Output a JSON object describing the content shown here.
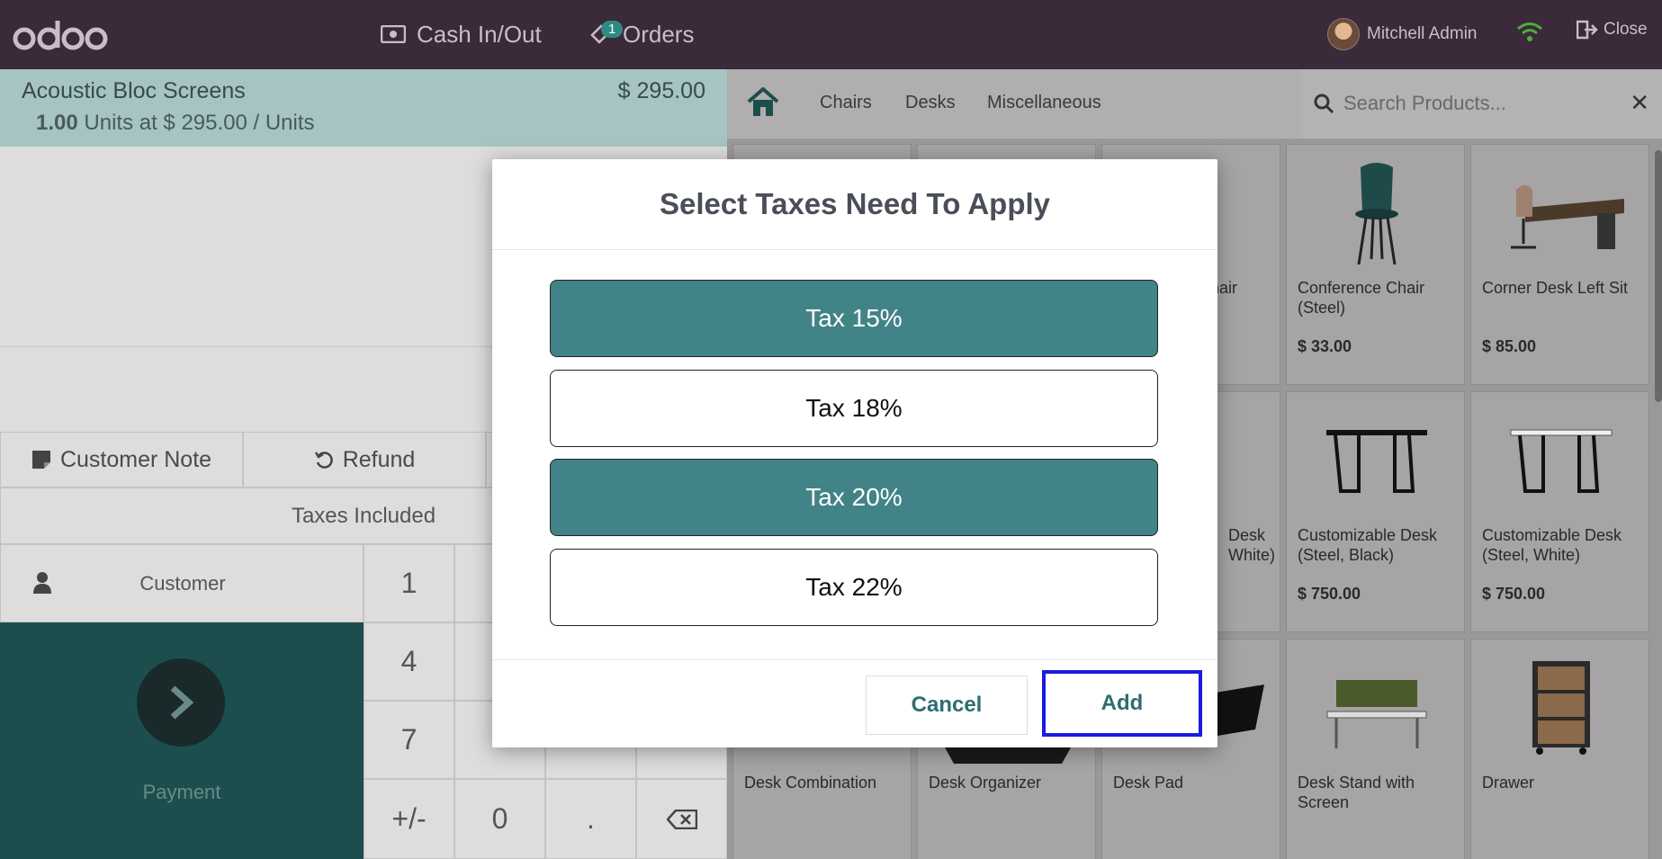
{
  "navbar": {
    "logo_text": "odoo",
    "cash_in_out_label": "Cash In/Out",
    "orders_label": "Orders",
    "orders_badge": "1",
    "user_name": "Mitchell Admin",
    "close_label": "Close"
  },
  "order": {
    "line_name": "Acoustic Bloc Screens",
    "line_price": "$ 295.00",
    "line_qty": "1.00",
    "line_unit_info": "Units at $ 295.00 / Units"
  },
  "controls": {
    "customer_note_label": "Customer Note",
    "refund_label": "Refund",
    "taxes_included_label": "Taxes Included",
    "customer_label": "Customer",
    "payment_label": "Payment"
  },
  "numpad": {
    "keys": [
      "1",
      "",
      "",
      "",
      "4",
      "",
      "",
      "",
      "7",
      "",
      "",
      "",
      "+/-",
      "0",
      ".",
      ""
    ]
  },
  "catalog": {
    "categories": [
      "Chairs",
      "Desks",
      "Miscellaneous"
    ],
    "search_placeholder": "Search Products...",
    "products": [
      {
        "name": "",
        "price": ""
      },
      {
        "name": "",
        "price": ""
      },
      {
        "name": "hair",
        "price": ""
      },
      {
        "name": "Conference Chair (Steel)",
        "price": "$ 33.00"
      },
      {
        "name": "Corner Desk Left Sit",
        "price": "$ 85.00"
      },
      {
        "name": "",
        "price": ""
      },
      {
        "name": "",
        "price": ""
      },
      {
        "name": "Desk White)",
        "price": ""
      },
      {
        "name": "Customizable Desk (Steel, Black)",
        "price": "$ 750.00"
      },
      {
        "name": "Customizable Desk (Steel, White)",
        "price": "$ 750.00"
      },
      {
        "name": "Desk Combination",
        "price": ""
      },
      {
        "name": "Desk Organizer",
        "price": ""
      },
      {
        "name": "Desk Pad",
        "price": ""
      },
      {
        "name": "Desk Stand with Screen",
        "price": ""
      },
      {
        "name": "Drawer",
        "price": ""
      }
    ]
  },
  "modal": {
    "title": "Select Taxes Need To Apply",
    "taxes": [
      {
        "label": "Tax 15%",
        "selected": true
      },
      {
        "label": "Tax 18%",
        "selected": false
      },
      {
        "label": "Tax 20%",
        "selected": true
      },
      {
        "label": "Tax 22%",
        "selected": false
      }
    ],
    "cancel_label": "Cancel",
    "add_label": "Add"
  },
  "colors": {
    "navbar_bg": "#3a2a3a",
    "selected_tax": "#428387",
    "focus_outline": "#1a1ae0",
    "payment_bg": "#1d4e4e"
  }
}
